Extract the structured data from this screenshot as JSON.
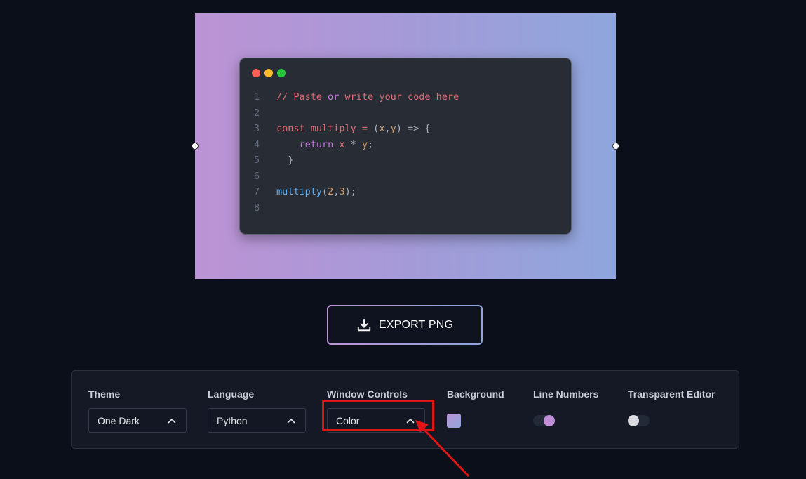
{
  "editor": {
    "lines": [
      {
        "num": "1",
        "text": ""
      },
      {
        "num": "2",
        "text": ""
      },
      {
        "num": "3",
        "text": ""
      },
      {
        "num": "4",
        "text": ""
      },
      {
        "num": "5",
        "text": ""
      },
      {
        "num": "6",
        "text": ""
      },
      {
        "num": "7",
        "text": ""
      },
      {
        "num": "8",
        "text": ""
      }
    ],
    "code": {
      "l1_comment": "// Paste ",
      "l1_or": "or",
      "l1_rest": " write your code here",
      "l3_const": "const multiply = ",
      "l3_open": "(",
      "l3_x": "x",
      "l3_comma": ",",
      "l3_y": "y",
      "l3_close": ") => {",
      "l4_indent": "    ",
      "l4_return": "return",
      "l4_x": " x",
      "l4_op": " * ",
      "l4_y": "y",
      "l4_semi": ";",
      "l5": "  }",
      "l7_fn": "multiply",
      "l7_open": "(",
      "l7_a": "2",
      "l7_comma": ",",
      "l7_b": "3",
      "l7_close": ");"
    }
  },
  "export_button": {
    "label": "EXPORT PNG",
    "icon": "download-icon"
  },
  "settings": {
    "theme": {
      "label": "Theme",
      "value": "One Dark"
    },
    "language": {
      "label": "Language",
      "value": "Python"
    },
    "window_controls": {
      "label": "Window Controls",
      "value": "Color"
    },
    "background": {
      "label": "Background",
      "color_start": "#bc93d4",
      "color_end": "#8ea6dc"
    },
    "line_numbers": {
      "label": "Line Numbers",
      "enabled": true
    },
    "transparent_editor": {
      "label": "Transparent Editor",
      "enabled": false
    }
  },
  "colors": {
    "page_bg": "#0b0f1a",
    "panel_bg": "#141925",
    "editor_bg": "#282c34",
    "highlight": "#e01515"
  }
}
